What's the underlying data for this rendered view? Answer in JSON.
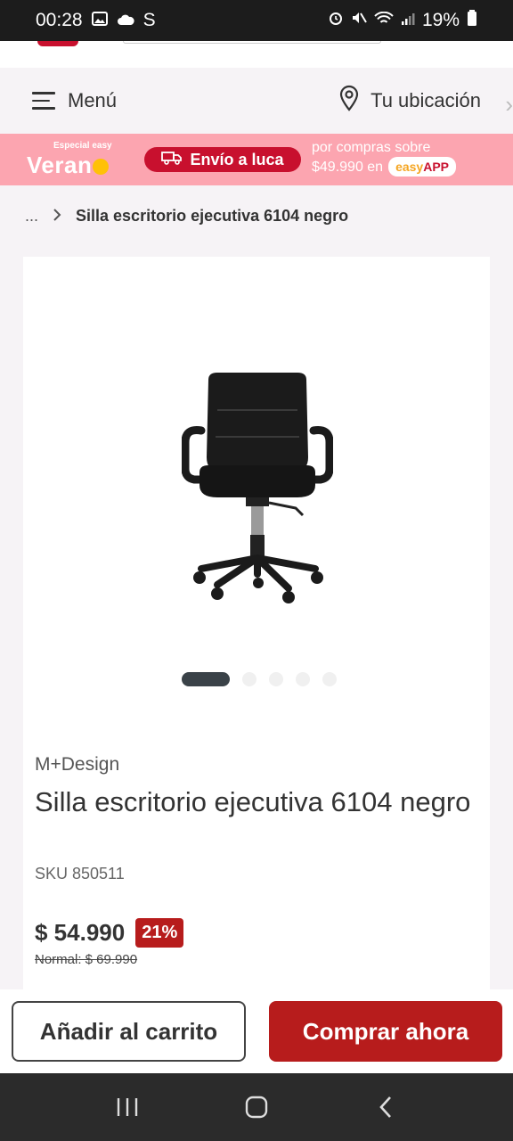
{
  "status_bar": {
    "time": "00:28",
    "carrier_letter": "S",
    "battery": "19%"
  },
  "menu_row": {
    "menu_label": "Menú",
    "location_label": "Tu ubicación"
  },
  "promo": {
    "special": "Especial easy",
    "season": "Veran",
    "shipping": "Envío a luca",
    "text_line1": "por compras sobre",
    "text_line2": "$49.990 en",
    "app_brand": "easy",
    "app_suffix": "APP"
  },
  "breadcrumb": {
    "ellipsis": "...",
    "current": "Silla escritorio ejecutiva 6104 negro"
  },
  "product": {
    "brand": "M+Design",
    "title": "Silla escritorio ejecutiva 6104 negro",
    "sku": "SKU 850511",
    "price": "$ 54.990",
    "discount": "21%",
    "normal_price": "Normal: $ 69.990",
    "gallery_total": 5,
    "gallery_active": 1
  },
  "actions": {
    "add_to_cart": "Añadir al carrito",
    "buy_now": "Comprar ahora"
  },
  "colors": {
    "brand_red": "#c8102e",
    "buy_button": "#b71c1c",
    "promo_bg": "#fca5b0"
  }
}
